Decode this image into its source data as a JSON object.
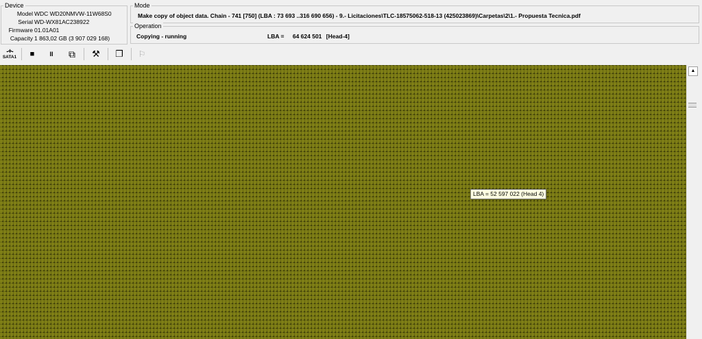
{
  "device": {
    "title": "Device",
    "fields": [
      {
        "label": "Model",
        "value": "WDC WD20NMVW-11W68S0"
      },
      {
        "label": "Serial",
        "value": "WD-WX81AC238922"
      },
      {
        "label": "Firmware",
        "value": "01.01A01"
      },
      {
        "label": "Capacity",
        "value": "1 863,02 GB (3 907 029 168)"
      }
    ]
  },
  "mode": {
    "title": "Mode",
    "text": "Make copy of object data. Chain - 741 [750] (LBA : 73 693 ..316 690 656) - 9.- Licitaciones\\TLC-18575062-518-13 (425023869)\\Carpetas\\2\\1.- Propuesta Tecnica.pdf"
  },
  "operation": {
    "title": "Operation",
    "status": "Copying - running",
    "lba_label": "LBA =",
    "lba_value": "64 624 501",
    "head": "[Head-4]"
  },
  "toolbar": {
    "sata_label": "SATA1",
    "stop_icon": "■",
    "pause_icon": "II",
    "export_icon": "⧉",
    "tools_icon": "⚒",
    "copy_icon": "❐",
    "run_icon": "⚐"
  },
  "tooltip": {
    "text": "LBA =  52 597 022 (Head 4)"
  },
  "colors": {
    "block_fill": "#8d8d1a",
    "block_border": "#3a3a08"
  }
}
